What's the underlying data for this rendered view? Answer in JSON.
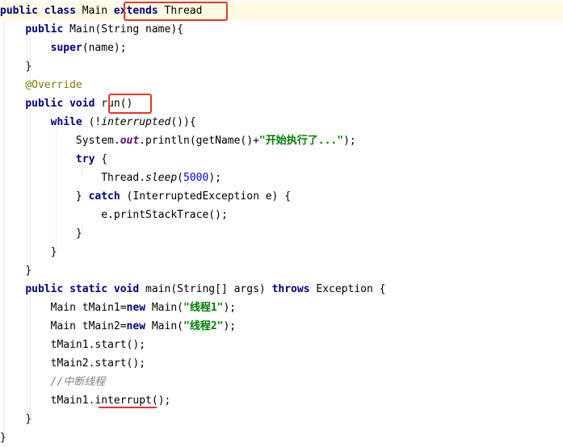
{
  "code": {
    "l1": {
      "kw1": "public class",
      "name": "Main",
      "kw2": "extends",
      "sup": "Thread"
    },
    "l2": {
      "kw": "public",
      "sig": "Main(String name){"
    },
    "l3": {
      "kw": "super",
      "rest": "(name);"
    },
    "l4": {
      "brace": "}"
    },
    "l5": {
      "ann": "@Override"
    },
    "l6": {
      "kw": "public void",
      "m": "run()"
    },
    "l7": {
      "kw": "while",
      "p1": "(!",
      "call": "interrupted",
      "p2": "()){"
    },
    "l8": {
      "a": "System.",
      "fld": "out",
      "b": ".println(getName()+",
      "str": "\"开始执行了...\"",
      "c": ");"
    },
    "l9": {
      "kw": "try",
      "rest": "{"
    },
    "l10": {
      "a": "Thread.",
      "call": "sleep",
      "b": "(",
      "num": "5000",
      "c": ");"
    },
    "l11": {
      "a": "}",
      "kw": "catch",
      "rest": "(InterruptedException e) {"
    },
    "l12": {
      "text": "e.printStackTrace();"
    },
    "l13": {
      "brace": "}"
    },
    "l14": {
      "brace": "}"
    },
    "l15": {
      "brace": "}"
    },
    "l16": {
      "kw1": "public static void",
      "a": "main(String[] args)",
      "kw2": "throws",
      "b": "Exception {"
    },
    "l17": {
      "a": "Main tMain1=",
      "kw": "new",
      "b": "Main(",
      "str": "\"线程1\"",
      "c": ");"
    },
    "l18": {
      "a": "Main tMain2=",
      "kw": "new",
      "b": "Main(",
      "str": "\"线程2\"",
      "c": ");"
    },
    "l19": {
      "text": "tMain1.start();"
    },
    "l20": {
      "text": "tMain2.start();"
    },
    "l21": {
      "cmt": "//中断线程"
    },
    "l22": {
      "a": "tMain1.",
      "m": "interrupt",
      "b": "();"
    },
    "l23": {
      "brace": "}"
    },
    "l24": {
      "brace": "}"
    }
  },
  "colors": {
    "keyword": "#000080",
    "string": "#008000",
    "number": "#0000ff",
    "annotation": "#808000",
    "comment": "#808080",
    "static_field": "#660e7a",
    "highlight_box": "#e8362a",
    "caret_line_bg": "#fffae3"
  }
}
